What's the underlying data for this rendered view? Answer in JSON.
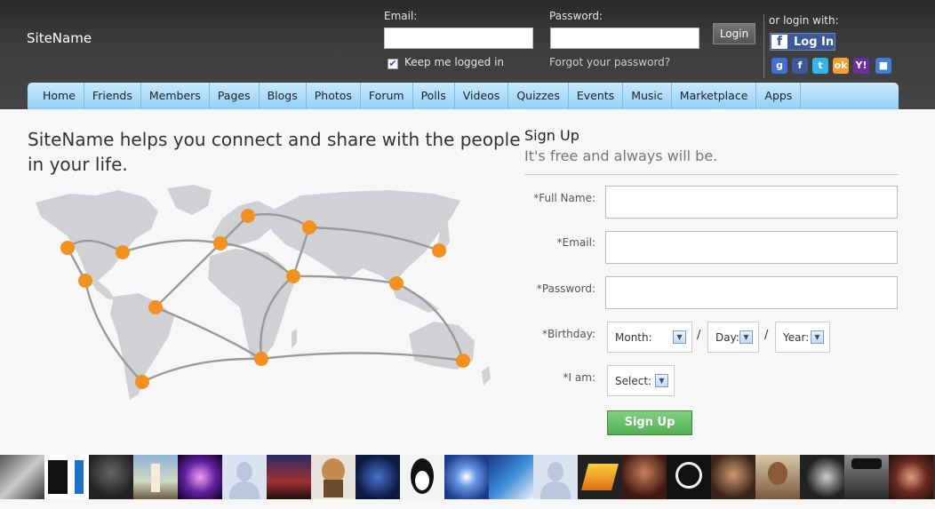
{
  "header": {
    "site_name": "SiteName",
    "email_label": "Email:",
    "email_value": "",
    "password_label": "Password:",
    "password_value": "",
    "keep_logged_in_label": "Keep me logged in",
    "keep_logged_in_checked": true,
    "forgot_password_label": "Forgot your password?",
    "login_button": "Login",
    "or_login_with": "or login with:",
    "facebook_login": "Log In",
    "social_icons": [
      "google-icon",
      "facebook-icon",
      "twitter-icon",
      "odnoklassniki-icon",
      "yahoo-icon",
      "windows-live-icon"
    ]
  },
  "nav": {
    "items": [
      "Home",
      "Friends",
      "Members",
      "Pages",
      "Blogs",
      "Photos",
      "Forum",
      "Polls",
      "Videos",
      "Quizzes",
      "Events",
      "Music",
      "Marketplace",
      "Apps"
    ]
  },
  "main": {
    "tagline": "SiteName helps you connect and share with the people in your life."
  },
  "signup": {
    "title": "Sign Up",
    "subtitle": "It's free and always will be.",
    "full_name_label": "*Full Name:",
    "email_label": "*Email:",
    "password_label": "*Password:",
    "birthday_label": "*Birthday:",
    "month_value": "Month:",
    "day_value": "Day:",
    "year_value": "Year:",
    "separator": "/",
    "i_am_label": "*I am:",
    "gender_value": "Select:",
    "submit_button": "Sign Up"
  },
  "colors": {
    "header_bg": "#3a3a3a",
    "nav_bg": "#a9dcf9",
    "map_land": "#cfd1d4",
    "map_dot": "#f4901e",
    "signup_button": "#5fbf5f",
    "facebook_blue": "#3b5998"
  }
}
